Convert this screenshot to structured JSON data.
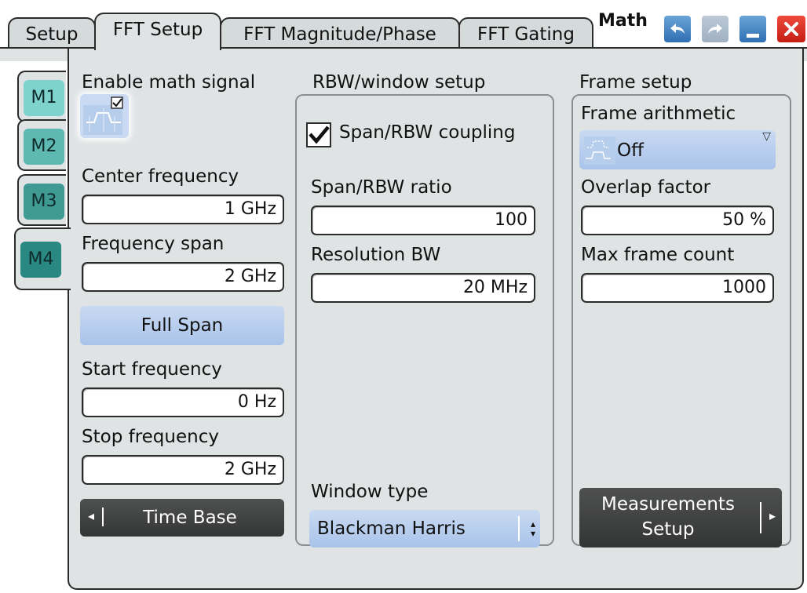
{
  "tabs": [
    {
      "label": "Setup"
    },
    {
      "label": "FFT Setup"
    },
    {
      "label": "FFT Magnitude/Phase"
    },
    {
      "label": "FFT Gating"
    }
  ],
  "window": {
    "title": "Math"
  },
  "side_tabs": [
    {
      "label": "M1",
      "color": "#7fd3cf"
    },
    {
      "label": "M2",
      "color": "#5db9b1"
    },
    {
      "label": "M3",
      "color": "#3f9a94"
    },
    {
      "label": "M4",
      "color": "#2a8882"
    }
  ],
  "left": {
    "enable_label": "Enable math signal",
    "enable_checked": true,
    "center_frequency": {
      "label": "Center frequency",
      "value": "1 GHz"
    },
    "frequency_span": {
      "label": "Frequency span",
      "value": "2 GHz"
    },
    "full_span_label": "Full Span",
    "start_frequency": {
      "label": "Start frequency",
      "value": "0 Hz"
    },
    "stop_frequency": {
      "label": "Stop frequency",
      "value": "2 GHz"
    },
    "time_base_label": "Time Base"
  },
  "rbw": {
    "title": "RBW/window setup",
    "coupling_label": "Span/RBW coupling",
    "coupling_checked": true,
    "ratio": {
      "label": "Span/RBW ratio",
      "value": "100"
    },
    "resolution_bw": {
      "label": "Resolution BW",
      "value": "20 MHz"
    },
    "window_type": {
      "label": "Window type",
      "value": "Blackman Harris"
    }
  },
  "frame": {
    "title": "Frame setup",
    "arithmetic": {
      "label": "Frame arithmetic",
      "value": "Off"
    },
    "overlap": {
      "label": "Overlap factor",
      "value": "50 %"
    },
    "max_count": {
      "label": "Max frame count",
      "value": "1000"
    },
    "measurements_line1": "Measurements",
    "measurements_line2": "Setup"
  }
}
